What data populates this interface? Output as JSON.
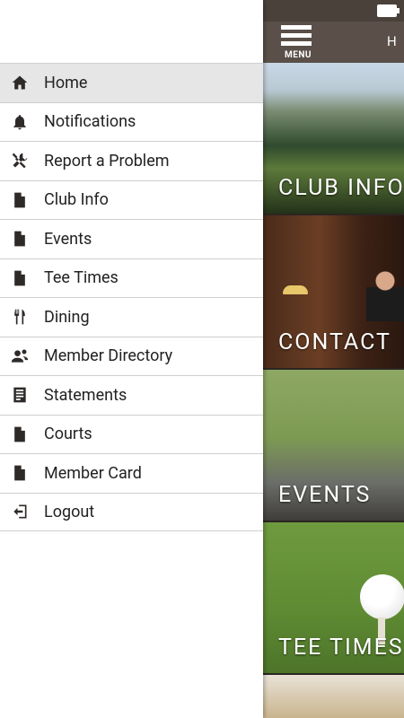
{
  "topbar": {
    "menu_label": "MENU",
    "title_partial": "H"
  },
  "drawer": {
    "items": [
      {
        "label": "Home",
        "icon": "home-icon",
        "active": true
      },
      {
        "label": "Notifications",
        "icon": "bell-icon"
      },
      {
        "label": "Report a Problem",
        "icon": "tools-icon"
      },
      {
        "label": "Club Info",
        "icon": "document-icon"
      },
      {
        "label": "Events",
        "icon": "document-icon"
      },
      {
        "label": "Tee Times",
        "icon": "document-icon"
      },
      {
        "label": "Dining",
        "icon": "fork-knife-icon"
      },
      {
        "label": "Member Directory",
        "icon": "people-icon"
      },
      {
        "label": "Statements",
        "icon": "statement-icon"
      },
      {
        "label": "Courts",
        "icon": "document-icon"
      },
      {
        "label": "Member Card",
        "icon": "document-icon"
      },
      {
        "label": "Logout",
        "icon": "logout-icon"
      }
    ]
  },
  "tiles": {
    "club_info": "CLUB INFO",
    "contact": "CONTACT",
    "events": "EVENTS",
    "tee_times": "TEE TIMES"
  },
  "colors": {
    "topbar": "#5a5049",
    "statusbar": "#4a413a",
    "active_row": "#e6e6e6",
    "icon": "#2e2a28"
  }
}
